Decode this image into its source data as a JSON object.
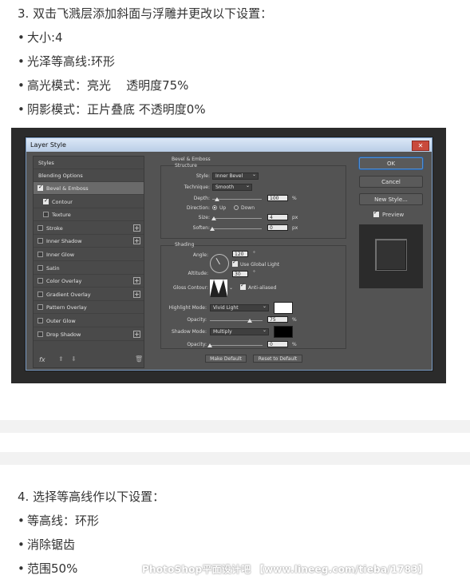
{
  "step3": {
    "title": "3. 双击飞溅层添加斜面与浮雕并更改以下设置：",
    "bullets": [
      "大小:4",
      "光泽等高线:环形",
      "高光模式：亮光    透明度75%",
      "阴影模式：正片叠底 不透明度0%"
    ]
  },
  "dialog": {
    "title": "Layer Style",
    "close": "✕",
    "styles_header": "Styles",
    "blending_options": "Blending Options",
    "items": [
      {
        "label": "Bevel & Emboss",
        "checked": true,
        "selected": true,
        "plus": false,
        "indent": false
      },
      {
        "label": "Contour",
        "checked": true,
        "selected": false,
        "plus": false,
        "indent": true
      },
      {
        "label": "Texture",
        "checked": false,
        "selected": false,
        "plus": false,
        "indent": true
      },
      {
        "label": "Stroke",
        "checked": false,
        "selected": false,
        "plus": true,
        "indent": false
      },
      {
        "label": "Inner Shadow",
        "checked": false,
        "selected": false,
        "plus": true,
        "indent": false
      },
      {
        "label": "Inner Glow",
        "checked": false,
        "selected": false,
        "plus": false,
        "indent": false
      },
      {
        "label": "Satin",
        "checked": false,
        "selected": false,
        "plus": false,
        "indent": false
      },
      {
        "label": "Color Overlay",
        "checked": false,
        "selected": false,
        "plus": true,
        "indent": false
      },
      {
        "label": "Gradient Overlay",
        "checked": false,
        "selected": false,
        "plus": true,
        "indent": false
      },
      {
        "label": "Pattern Overlay",
        "checked": false,
        "selected": false,
        "plus": false,
        "indent": false
      },
      {
        "label": "Outer Glow",
        "checked": false,
        "selected": false,
        "plus": false,
        "indent": false
      },
      {
        "label": "Drop Shadow",
        "checked": false,
        "selected": false,
        "plus": true,
        "indent": false
      }
    ],
    "fx": "fx",
    "bevel": {
      "section_title": "Bevel & Emboss",
      "structure_title": "Structure",
      "style_label": "Style:",
      "style_value": "Inner Bevel",
      "technique_label": "Technique:",
      "technique_value": "Smooth",
      "depth_label": "Depth:",
      "depth_value": "100",
      "depth_unit": "%",
      "depth_level": 0.1,
      "direction_label": "Direction:",
      "direction_up": "Up",
      "direction_down": "Down",
      "size_label": "Size:",
      "size_value": "4",
      "size_unit": "px",
      "size_level": 0.03,
      "soften_label": "Soften:",
      "soften_value": "0",
      "soften_unit": "px",
      "soften_level": 0.0,
      "shading_title": "Shading",
      "angle_label": "Angle:",
      "angle_value": "120",
      "angle_unit": "°",
      "global_light": "Use Global Light",
      "altitude_label": "Altitude:",
      "altitude_value": "30",
      "altitude_unit": "°",
      "gloss_label": "Gloss Contour:",
      "anti_aliased": "Anti-aliased",
      "highlight_label": "Highlight Mode:",
      "highlight_value": "Vivid Light",
      "highlight_color": "#ffffff",
      "h_opacity_label": "Opacity:",
      "h_opacity_value": "75",
      "h_opacity_unit": "%",
      "h_opacity_level": 0.75,
      "shadow_label": "Shadow Mode:",
      "shadow_value": "Multiply",
      "shadow_color": "#000000",
      "s_opacity_label": "Opacity:",
      "s_opacity_value": "0",
      "s_opacity_unit": "%",
      "s_opacity_level": 0.0,
      "make_default": "Make Default",
      "reset_default": "Reset to Default"
    },
    "buttons": {
      "ok": "OK",
      "cancel": "Cancel",
      "new_style": "New Style...",
      "preview": "Preview"
    }
  },
  "step4": {
    "title": "4.  选择等高线作以下设置：",
    "bullets": [
      "等高线：环形",
      "消除锯齿",
      "范围50%"
    ]
  },
  "watermark": "PhotoShop平面设计吧 【www.lineeg.com/tieba/1783】"
}
